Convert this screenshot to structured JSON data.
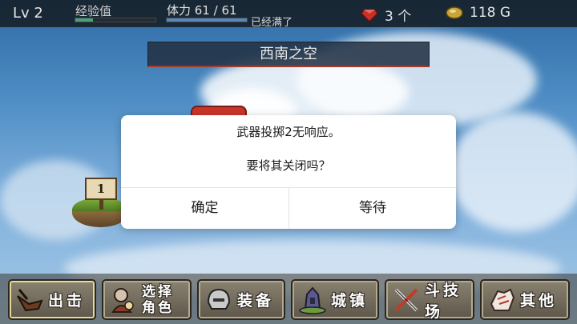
{
  "status": {
    "level": "Lv 2",
    "exp_label": "经验值",
    "exp_progress": 0.22,
    "stamina_label": "体力 61 / 61",
    "stamina_progress": 1.0,
    "stamina_status": "已经满了",
    "gems": "3 个",
    "gold": "118 G"
  },
  "location": "西南之空",
  "signpost": "1",
  "dialog": {
    "message_line1": "武器投掷2无响应。",
    "message_line2": "要将其关闭吗？",
    "ok_label": "确定",
    "wait_label": "等待"
  },
  "menu": {
    "sortie": "出击",
    "select_line1": "选择",
    "select_line2": "角色",
    "equip": "装备",
    "town": "城镇",
    "arena": "斗技场",
    "other": "其他"
  },
  "colors": {
    "exp_fill": "#4fa07a",
    "stamina_fill": "#5c86b8",
    "location_accent": "#a33a2c"
  },
  "icons": [
    "gem-icon",
    "gold-coin-icon",
    "bird-icon",
    "character-icon",
    "helmet-icon",
    "town-icon",
    "swords-icon",
    "hand-icon"
  ]
}
